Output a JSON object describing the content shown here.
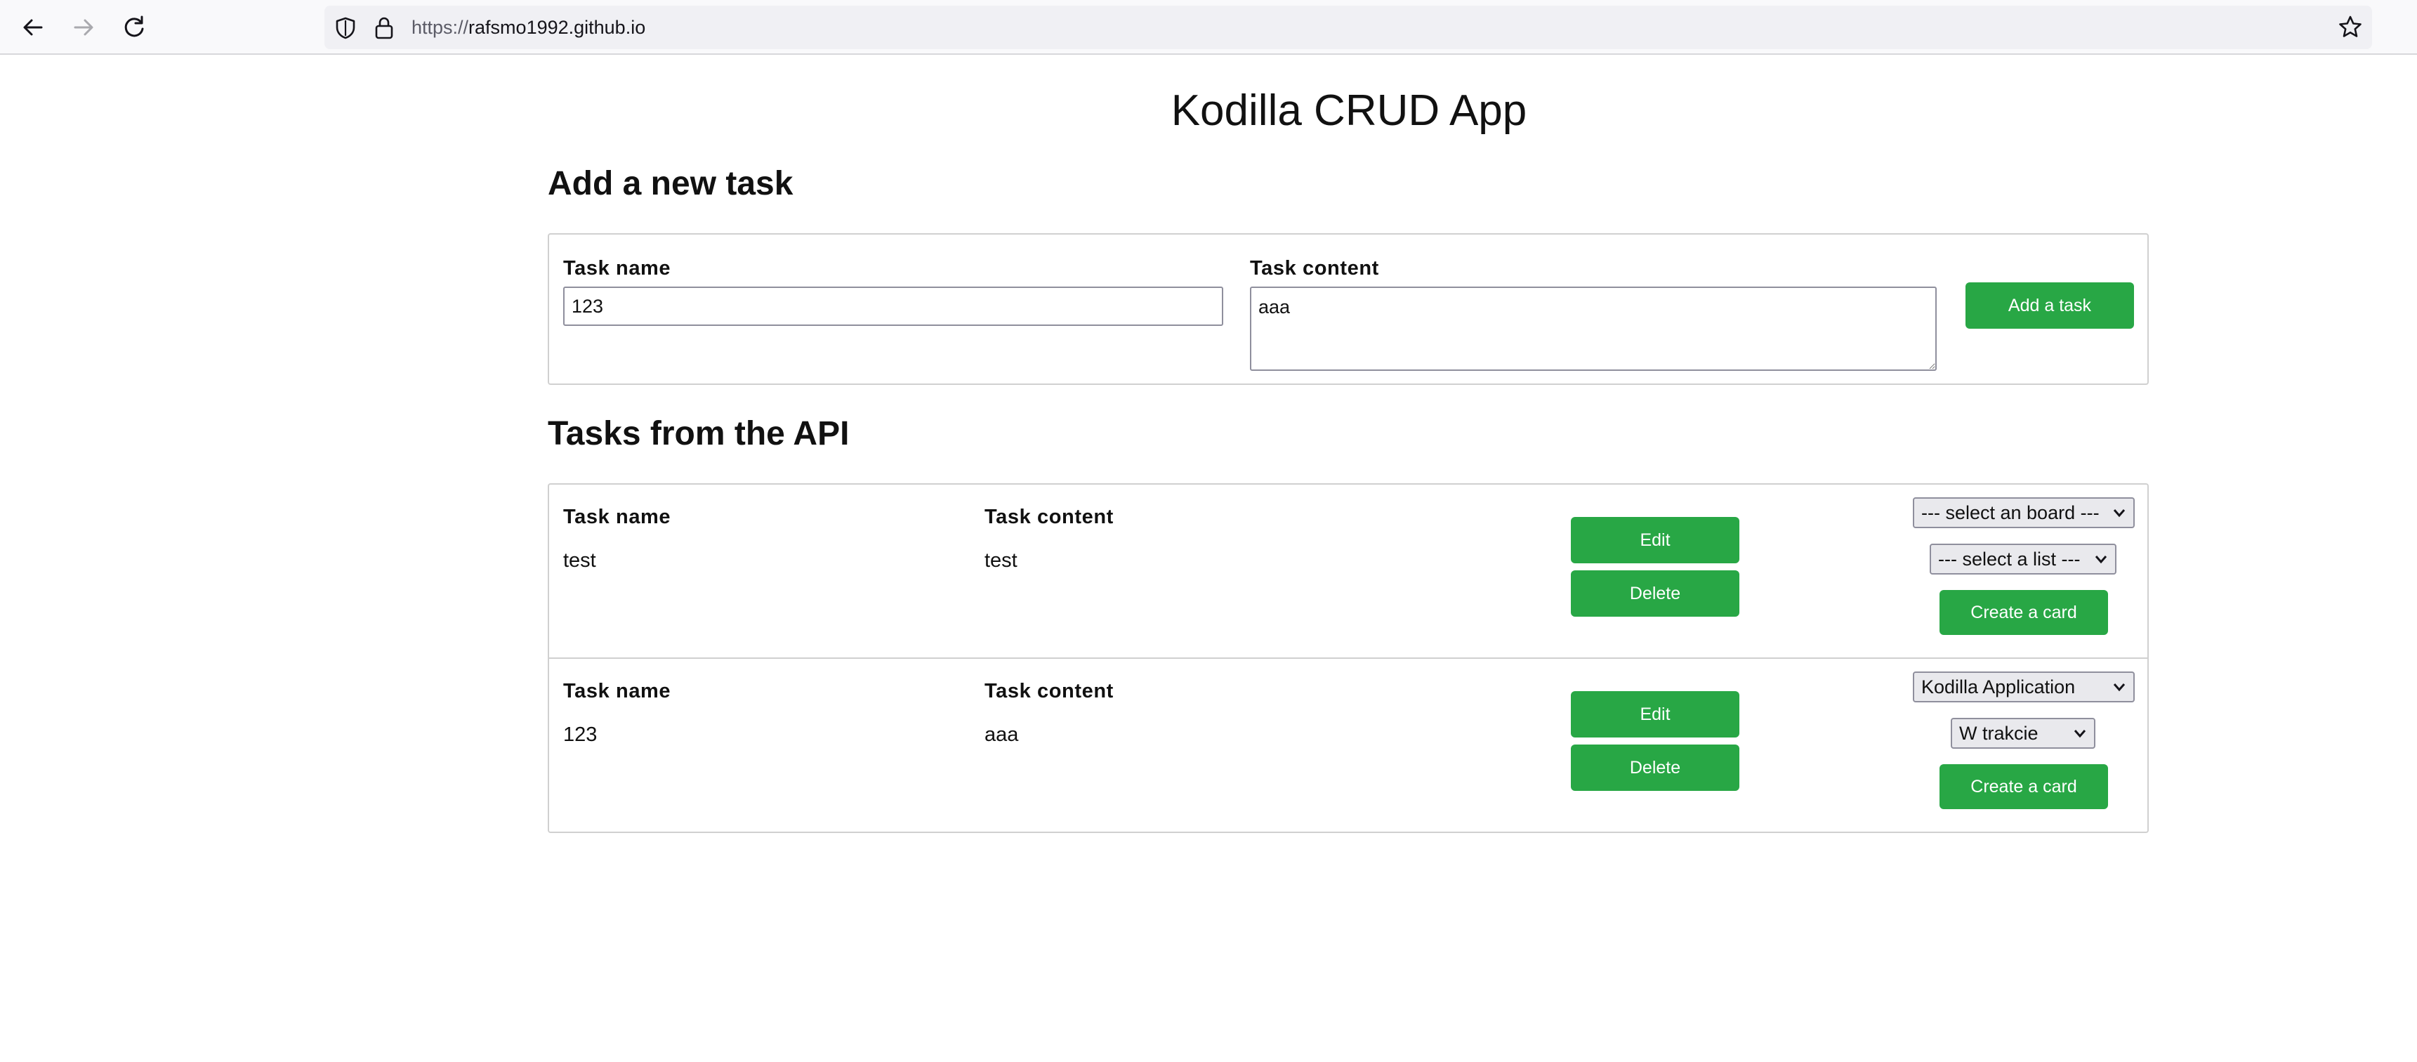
{
  "browser": {
    "url_scheme": "https://",
    "url_host": "rafsmo1992.github.io"
  },
  "icons": {
    "back": "arrow-left-icon",
    "forward": "arrow-right-icon",
    "reload": "reload-icon",
    "shield": "shield-icon",
    "lock": "lock-icon",
    "bookmark": "star-icon"
  },
  "colors": {
    "button": "#28a745",
    "border": "#d0d0d0"
  },
  "page": {
    "title": "Kodilla CRUD App",
    "add_section": {
      "heading": "Add a new task",
      "name_label": "Task name",
      "name_value": "123",
      "content_label": "Task content",
      "content_value": "aaa",
      "add_button": "Add a task"
    },
    "tasks_section": {
      "heading": "Tasks from the API",
      "tasks": [
        {
          "name_label": "Task name",
          "name": "test",
          "content_label": "Task content",
          "content": "test",
          "edit_button": "Edit",
          "delete_button": "Delete",
          "board_select": "--- select an board ---",
          "list_select": "--- select a list ---",
          "create_button": "Create a card"
        },
        {
          "name_label": "Task name",
          "name": "123",
          "content_label": "Task content",
          "content": "aaa",
          "edit_button": "Edit",
          "delete_button": "Delete",
          "board_select": "Kodilla Application",
          "list_select": "W trakcie",
          "create_button": "Create a card"
        }
      ]
    }
  }
}
